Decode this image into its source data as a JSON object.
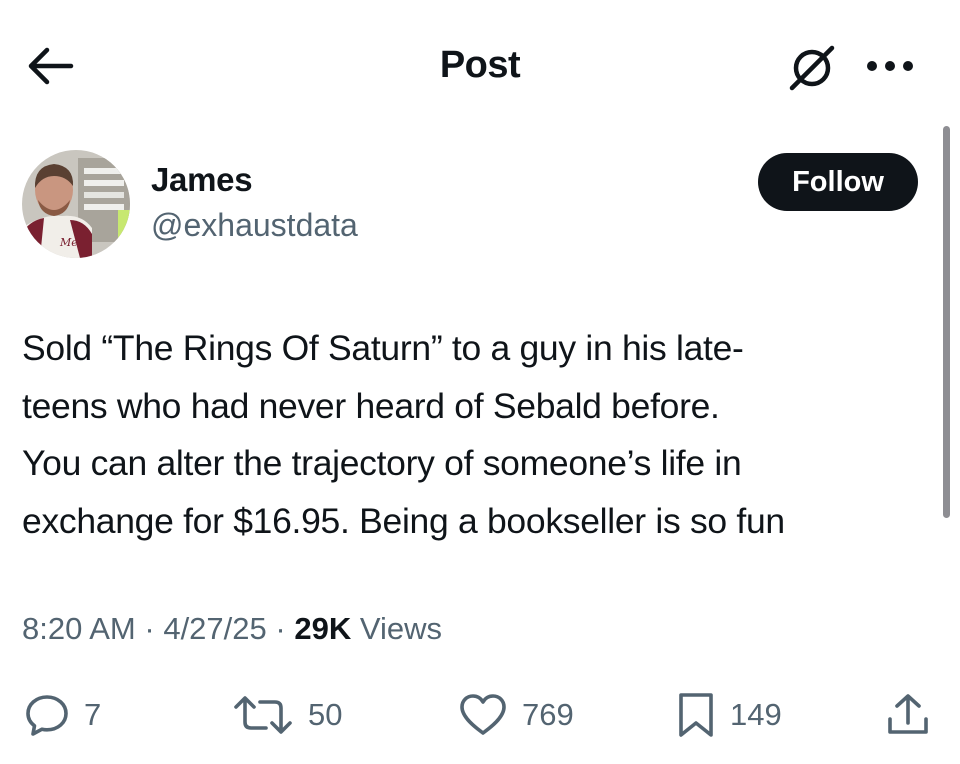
{
  "header": {
    "title": "Post",
    "back_icon": "arrow-left-icon",
    "grok_icon": "grok-icon",
    "more_icon": "more-horizontal-icon"
  },
  "author": {
    "name": "James",
    "handle": "@exhaustdata",
    "follow_label": "Follow"
  },
  "post": {
    "lines": [
      "Sold “The Rings Of Saturn” to a guy in his late-",
      "teens who had never heard of Sebald before.",
      "You can alter the trajectory of someone’s life in",
      "exchange for $16.95. Being a bookseller is so fun"
    ],
    "time": "8:20 AM",
    "date": "4/27/25",
    "separator": "·",
    "views_count": "29K",
    "views_label": "Views"
  },
  "actions": {
    "replies": "7",
    "reposts": "50",
    "likes": "769",
    "bookmarks": "149"
  },
  "colors": {
    "text_primary": "#0f1419",
    "text_secondary": "#536471",
    "follow_bg": "#0f1419",
    "background": "#ffffff"
  }
}
